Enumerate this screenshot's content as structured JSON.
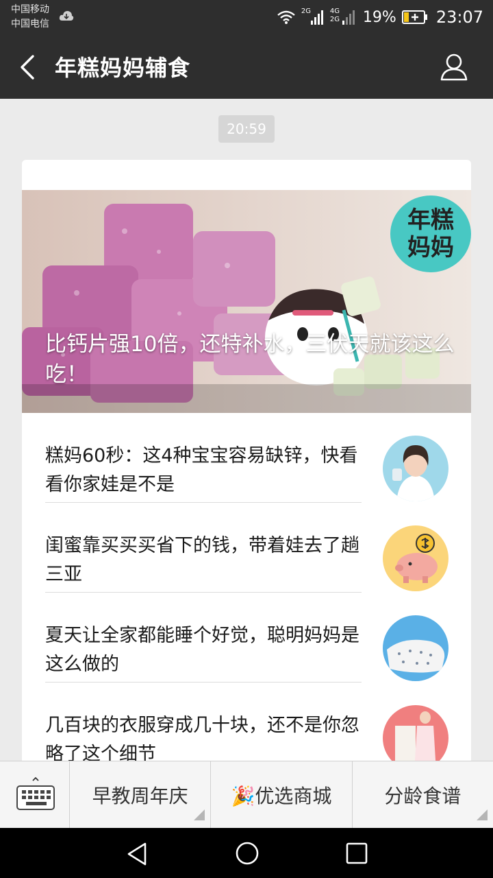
{
  "status_bar": {
    "carrier_1": "中国移动",
    "carrier_2": "中国电信",
    "net_1": "2G",
    "net_2a": "4G",
    "net_2b": "2G",
    "battery": "19%",
    "time": "23:07"
  },
  "header": {
    "title": "年糕妈妈辅食"
  },
  "chat": {
    "timestamp": "20:59"
  },
  "article": {
    "hero_title": "比钙片强10倍，还特补水，三伏天就该这么吃！",
    "brand_logo_line1": "年糕",
    "brand_logo_line2": "妈妈",
    "items": [
      {
        "title": "糕妈60秒：这4种宝宝容易缺锌，快看看你家娃是不是"
      },
      {
        "title": "闺蜜靠买买买省下的钱，带着娃去了趟三亚"
      },
      {
        "title": "夏天让全家都能睡个好觉，聪明妈妈是这么做的"
      },
      {
        "title": "几百块的衣服穿成几十块，还不是你忽略了这个细节"
      }
    ]
  },
  "menu": {
    "item_1": "早教周年庆",
    "item_2": "🎉优选商城",
    "item_3": "分龄食谱"
  },
  "colors": {
    "top_bar": "#2e2e2e",
    "logo_teal": "#48c8c3",
    "background": "#ebebeb"
  }
}
